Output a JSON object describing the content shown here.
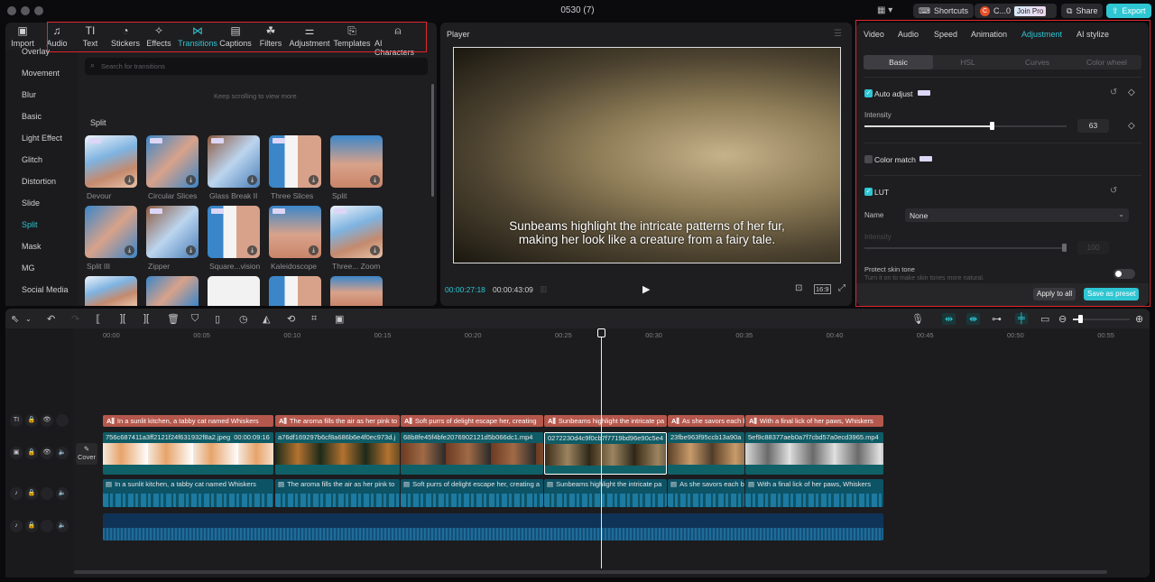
{
  "window": {
    "title": "0530 (7)",
    "shortcuts_label": "Shortcuts",
    "user_label": "C...0",
    "user_initial": "C",
    "join_pro_label": "Join Pro",
    "share_label": "Share",
    "export_label": "Export",
    "accent_color": "#2ec6d3"
  },
  "toolbar": {
    "items": [
      {
        "label": "Import",
        "icon": "import-icon"
      },
      {
        "label": "Audio",
        "icon": "audio-icon"
      },
      {
        "label": "Text",
        "icon": "text-icon"
      },
      {
        "label": "Stickers",
        "icon": "stickers-icon"
      },
      {
        "label": "Effects",
        "icon": "effects-icon"
      },
      {
        "label": "Transitions",
        "icon": "transitions-icon",
        "active": true
      },
      {
        "label": "Captions",
        "icon": "captions-icon"
      },
      {
        "label": "Filters",
        "icon": "filters-icon"
      },
      {
        "label": "Adjustment",
        "icon": "adjustment-icon"
      },
      {
        "label": "Templates",
        "icon": "templates-icon"
      },
      {
        "label": "AI Characters",
        "icon": "ai-characters-icon"
      }
    ]
  },
  "transitions": {
    "categories": [
      "Overlay",
      "Movement",
      "Blur",
      "Basic",
      "Light Effect",
      "Glitch",
      "Distortion",
      "Slide",
      "Split",
      "Mask",
      "MG",
      "Social Media"
    ],
    "active_category": "Split",
    "search_placeholder": "Search for transitions",
    "scroll_hint": "Keep scrolling to view more",
    "section_title": "Split",
    "items": [
      {
        "label": "Devour",
        "pro": true
      },
      {
        "label": "Circular Slices",
        "pro": true
      },
      {
        "label": "Glass Break II",
        "pro": true
      },
      {
        "label": "Three Slices",
        "pro": true
      },
      {
        "label": "Split",
        "pro": false
      },
      {
        "label": "Split III",
        "pro": false
      },
      {
        "label": "Zipper",
        "pro": true
      },
      {
        "label": "Square...vision",
        "pro": true
      },
      {
        "label": "Kaleidoscope",
        "pro": true
      },
      {
        "label": "Three... Zoom",
        "pro": true
      }
    ]
  },
  "player": {
    "title": "Player",
    "subtitle": "Sunbeams highlight the intricate patterns of her fur, making her look like a creature from a fairy tale.",
    "current_time": "00:00:27:18",
    "total_time": "00:00:43:09",
    "aspect_ratio": "16:9"
  },
  "inspector": {
    "tabs": [
      "Video",
      "Audio",
      "Speed",
      "Animation",
      "Adjustment",
      "AI stylize"
    ],
    "active_tab": "Adjustment",
    "subtabs": [
      "Basic",
      "HSL",
      "Curves",
      "Color wheel"
    ],
    "active_subtab": "Basic",
    "auto_adjust": {
      "label": "Auto adjust",
      "checked": true,
      "intensity_label": "Intensity",
      "intensity": 63
    },
    "color_match": {
      "label": "Color match",
      "checked": false
    },
    "lut": {
      "label": "LUT",
      "checked": true,
      "name_label": "Name",
      "name_value": "None",
      "intensity_label": "Intensity",
      "intensity": 100
    },
    "protect_skin": {
      "label": "Protect skin tone",
      "description": "Turn it on to make skin tones more natural.",
      "on": false
    },
    "apply_all_label": "Apply to all",
    "save_preset_label": "Save as preset"
  },
  "timeline": {
    "ruler": [
      "00:00",
      "00:05",
      "00:10",
      "00:15",
      "00:20",
      "00:25",
      "00:30",
      "00:35",
      "00:40",
      "00:45",
      "00:50",
      "00:55"
    ],
    "cover_label": "Cover",
    "text_clips": [
      "In a sunlit kitchen, a tabby cat named Whiskers",
      "The aroma fills the air as her pink to",
      "Soft purrs of delight escape her, creating",
      "Sunbeams highlight the intricate pa",
      "As she savors each b",
      "With a final lick of her paws, Whiskers"
    ],
    "video_clips": [
      {
        "name": "756c687411a3ff2121f24f631932f8a2.jpeg",
        "duration": "00:00:09:16"
      },
      {
        "name": "a76df169297b6cf8a686b6e4f0ec973d.j",
        "duration": ""
      },
      {
        "name": "68b8fe45f4bfe2076902121d5b066dc1.mp4",
        "duration": ""
      },
      {
        "name": "0272230d4c9f0cb7f7719bd96e90c5e4",
        "duration": ""
      },
      {
        "name": "23fbe963f95ccb13a90a",
        "duration": ""
      },
      {
        "name": "5ef9c88377aeb0a7f7cbd57a0ecd3965.mp4",
        "duration": ""
      }
    ],
    "audio_clips": [
      "In a sunlit kitchen, a tabby cat named Whiskers",
      "The aroma fills the air as her pink to",
      "Soft purrs of delight escape her, creating a",
      "Sunbeams highlight the intricate pa",
      "As she savors each b",
      "With a final lick of her paws, Whiskers"
    ]
  }
}
